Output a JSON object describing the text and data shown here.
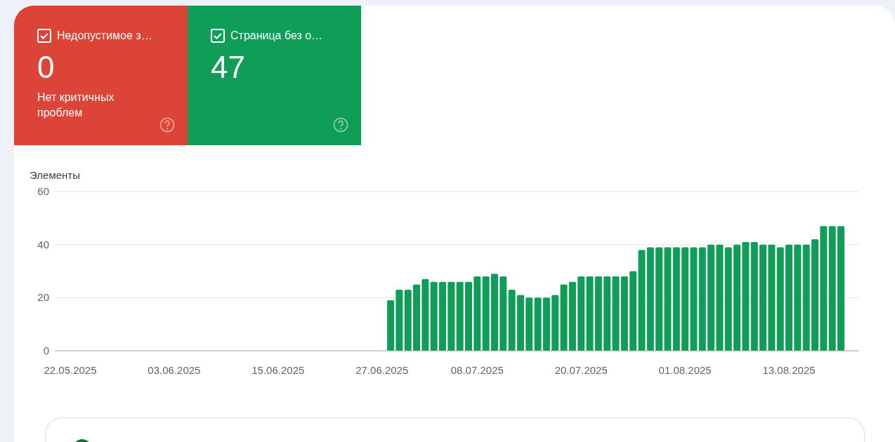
{
  "summary_cards": [
    {
      "title": "Недопустимое з…",
      "checked": true,
      "value": "0",
      "subtitle": "Нет критичных проблем",
      "color": "#db4437"
    },
    {
      "title": "Страница без о…",
      "checked": true,
      "value": "47",
      "color": "#0f9d58"
    }
  ],
  "chart": {
    "chart_data": {
      "type": "bar",
      "ylabel": "Элементы",
      "categories": [
        "22.05.2025",
        null,
        null,
        null,
        null,
        null,
        null,
        null,
        null,
        null,
        null,
        null,
        "03.06.2025",
        null,
        null,
        null,
        null,
        null,
        null,
        null,
        null,
        null,
        null,
        null,
        "15.06.2025",
        null,
        null,
        null,
        null,
        null,
        null,
        null,
        null,
        null,
        null,
        null,
        "27.06.2025",
        null,
        null,
        null,
        null,
        null,
        null,
        null,
        null,
        null,
        null,
        "08.07.2025",
        null,
        null,
        null,
        null,
        null,
        null,
        null,
        null,
        null,
        null,
        null,
        "20.07.2025",
        null,
        null,
        null,
        null,
        null,
        null,
        null,
        null,
        null,
        null,
        null,
        "01.08.2025",
        null,
        null,
        null,
        null,
        null,
        null,
        null,
        null,
        null,
        null,
        null,
        "13.08.2025",
        null,
        null,
        null,
        null,
        null,
        null
      ],
      "series": [
        {
          "color": "#0f9d58",
          "values": [
            null,
            null,
            null,
            null,
            null,
            null,
            null,
            null,
            null,
            null,
            null,
            null,
            null,
            null,
            null,
            null,
            null,
            null,
            null,
            null,
            null,
            null,
            null,
            null,
            null,
            null,
            null,
            null,
            null,
            null,
            null,
            null,
            null,
            null,
            null,
            null,
            null,
            19,
            23,
            23,
            25,
            27,
            26,
            26,
            26,
            26,
            26,
            28,
            28,
            29,
            28,
            23,
            21,
            20,
            20,
            20,
            21,
            25,
            26,
            28,
            28,
            28,
            28,
            28,
            28,
            30,
            38,
            39,
            39,
            39,
            39,
            39,
            39,
            39,
            40,
            40,
            39,
            40,
            41,
            41,
            40,
            40,
            39,
            40,
            40,
            40,
            42,
            47,
            47,
            47
          ]
        }
      ],
      "ylim": [
        0,
        60
      ],
      "yticks": [
        0,
        20,
        40,
        60
      ]
    }
  },
  "details_card": {
    "status_ok": true
  }
}
